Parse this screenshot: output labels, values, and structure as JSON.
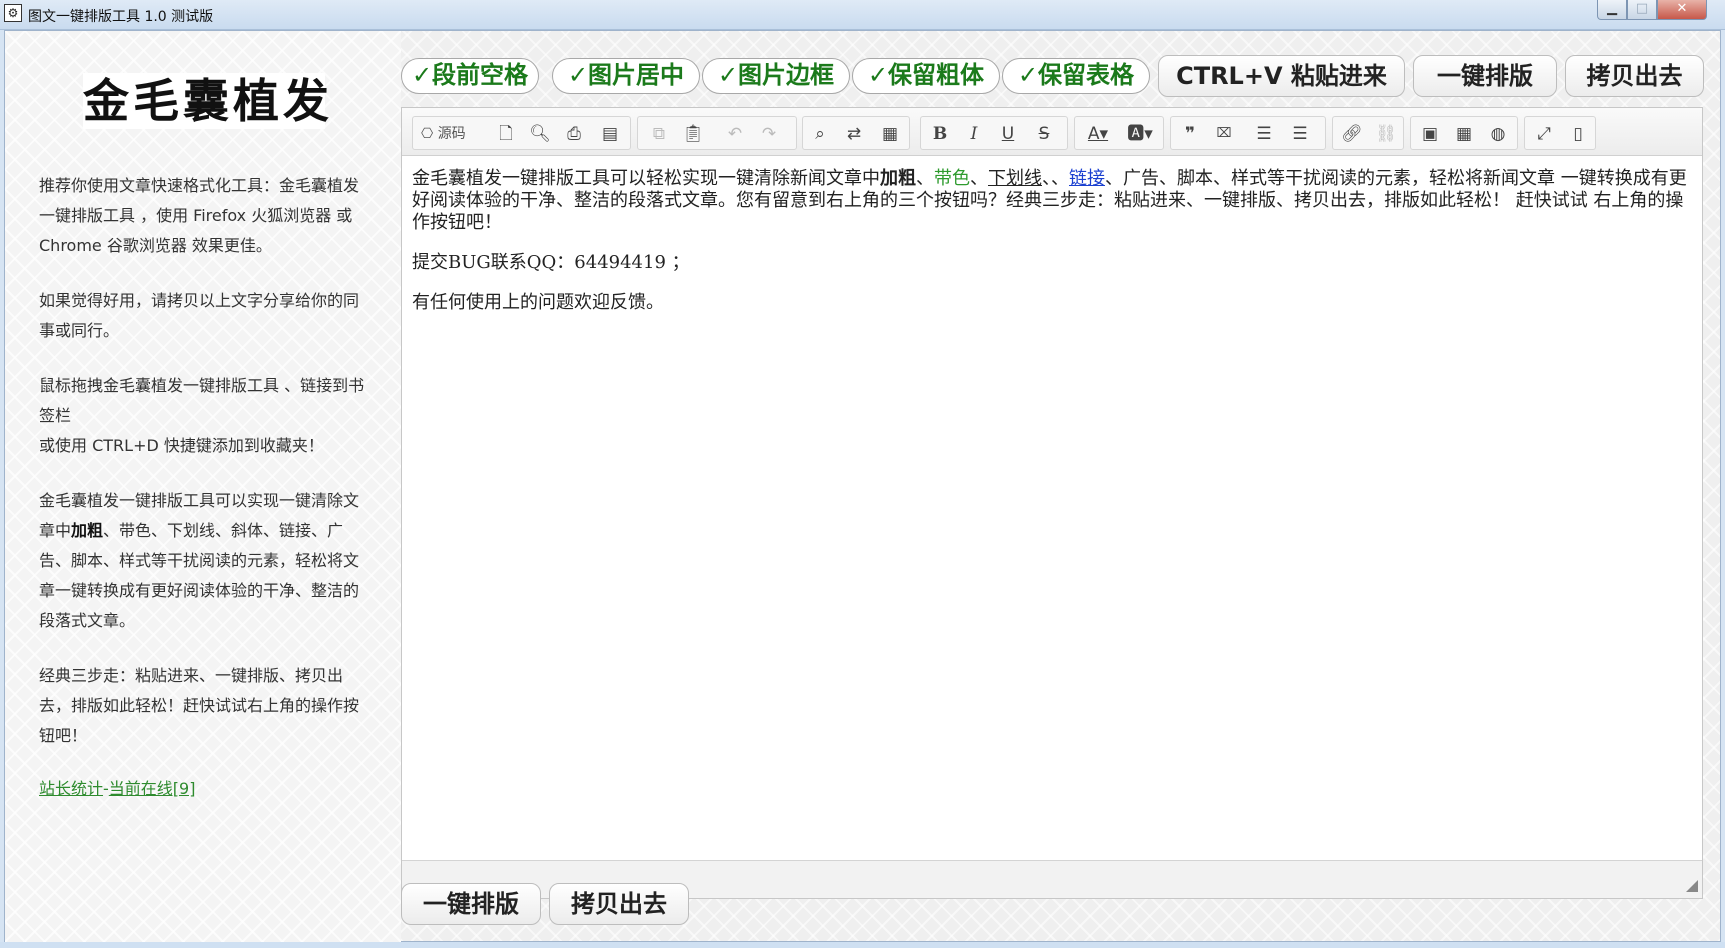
{
  "window": {
    "title": "图文一键排版工具 1.0 测试版",
    "icon": "app-logo-icon",
    "min_label": "▁",
    "max_label": "□",
    "close_label": "✕"
  },
  "sidebar": {
    "logo_text": "金毛囊植发",
    "p1": "推荐你使用文章快速格式化工具：金毛囊植发一键排版工具 ，使用 Firefox 火狐浏览器 或 Chrome 谷歌浏览器 效果更佳。",
    "p2": "如果觉得好用，请拷贝以上文字分享给你的同事或同行。",
    "p3a": "鼠标拖拽金毛囊植发一键排版工具 、链接到书签栏",
    "p3b": "或使用 CTRL+D 快捷键添加到收藏夹！",
    "p4a": "金毛囊植发一键排版工具可以实现一键清除文章中",
    "p4bold": "加粗",
    "p4b": "、带色、下划线、斜体、链接、广告、脚本、样式等干扰阅读的元素，轻松将文章一键转换成有更好阅读体验的干净、整洁的段落式文章。",
    "p5": "经典三步走：粘贴进来、一键排版、拷贝出去，排版如此轻松！赶快试试右上角的操作按钮吧！",
    "link1": "站长统计",
    "sep": "-",
    "link2": "当前在线[9]"
  },
  "options": [
    {
      "label": "✓段前空格"
    },
    {
      "label": "✓图片居中"
    },
    {
      "label": "✓图片边框"
    },
    {
      "label": "✓保留粗体"
    },
    {
      "label": "✓保留表格"
    }
  ],
  "actions": {
    "paste": "CTRL+V 粘贴进来",
    "format": "一键排版",
    "copy": "拷贝出去"
  },
  "bottom_actions": {
    "format": "一键排版",
    "copy": "拷贝出去"
  },
  "toolbar": {
    "source_label": "源码",
    "icons": [
      "source-icon",
      "new-page-icon",
      "preview-icon",
      "print-icon",
      "templates-icon",
      "copy-icon",
      "paste-icon",
      "undo-icon",
      "redo-icon",
      "find-icon",
      "replace-icon",
      "select-all-icon",
      "bold-icon",
      "italic-icon",
      "underline-icon",
      "strike-icon",
      "text-color-icon",
      "bg-color-icon",
      "blockquote-icon",
      "remove-format-icon",
      "align-left-icon",
      "align-right-icon",
      "link-icon",
      "unlink-icon",
      "image-icon",
      "table-icon",
      "iframe-icon",
      "maximize-icon",
      "show-blocks-icon"
    ]
  },
  "content": {
    "para1_a": "金毛囊植发一键排版工具可以轻松实现一键清除新闻文章中",
    "para1_bold": "加粗",
    "para1_sep1": "、",
    "para1_color": "带色",
    "para1_sep2": "、",
    "para1_under": "下划线",
    "para1_sep3": "、、",
    "para1_link": "链接",
    "para1_b": "、广告、脚本、样式等干扰阅读的元素，轻松将新闻文章 一键转换成有更好阅读体验的干净、整洁的段落式文章。您有留意到右上角的三个按钮吗？经典三步走：粘贴进来、一键排版、拷贝出去，排版如此轻松！ 赶快试试 右上角的操作按钮吧！",
    "para2": "提交BUG联系QQ：64494419 ；",
    "para3": "有任何使用上的问题欢迎反馈。"
  }
}
